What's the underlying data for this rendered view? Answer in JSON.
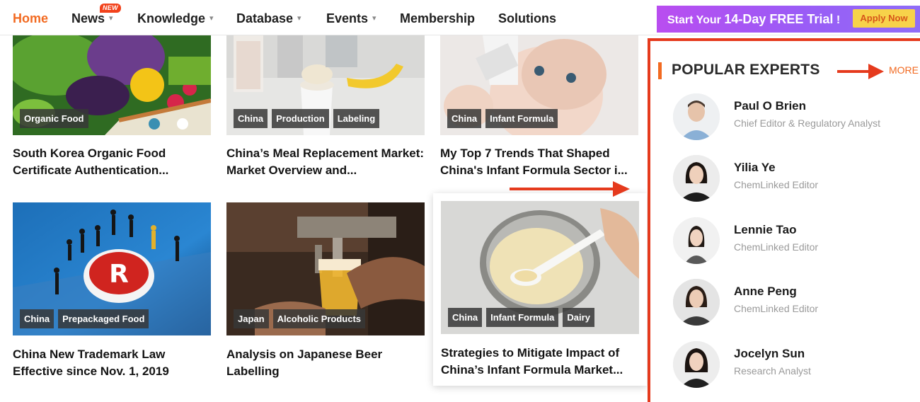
{
  "nav": {
    "items": [
      {
        "label": "Home",
        "active": true,
        "dropdown": false
      },
      {
        "label": "News",
        "active": false,
        "dropdown": true
      },
      {
        "label": "Knowledge",
        "active": false,
        "dropdown": true
      },
      {
        "label": "Database",
        "active": false,
        "dropdown": true
      },
      {
        "label": "Events",
        "active": false,
        "dropdown": true
      },
      {
        "label": "Membership",
        "active": false,
        "dropdown": false
      },
      {
        "label": "Solutions",
        "active": false,
        "dropdown": false
      }
    ],
    "new_badge": "NEW",
    "trial": {
      "text_prefix": "Start Your ",
      "text_highlight": "14-Day FREE Trial",
      "text_suffix": " !",
      "apply_label": "Apply Now"
    }
  },
  "articles": [
    {
      "tags": [
        "Organic Food"
      ],
      "title": "South Korea Organic Food Certificate Authentication..."
    },
    {
      "tags": [
        "China",
        "Production",
        "Labeling"
      ],
      "title": "China’s Meal Replacement Market: Market Overview and..."
    },
    {
      "tags": [
        "China",
        "Infant Formula"
      ],
      "title": "My Top 7 Trends That Shaped China's Infant Formula Sector i..."
    },
    {
      "tags": [
        "China",
        "Prepackaged Food"
      ],
      "title": "China New Trademark Law Effective since Nov. 1, 2019"
    },
    {
      "tags": [
        "Japan",
        "Alcoholic Products"
      ],
      "title": "Analysis on Japanese Beer Labelling"
    },
    {
      "tags": [
        "China",
        "Infant Formula",
        "Dairy"
      ],
      "title": "Strategies to Mitigate Impact of China’s Infant Formula Market..."
    }
  ],
  "sidebar": {
    "title": "POPULAR EXPERTS",
    "more_label": "MORE",
    "experts": [
      {
        "name": "Paul O Brien",
        "role": "Chief Editor & Regulatory Analyst"
      },
      {
        "name": "Yilia Ye",
        "role": "ChemLinked Editor"
      },
      {
        "name": "Lennie Tao",
        "role": "ChemLinked Editor"
      },
      {
        "name": "Anne Peng",
        "role": "ChemLinked Editor"
      },
      {
        "name": "Jocelyn Sun",
        "role": "Research Analyst"
      }
    ]
  },
  "colors": {
    "accent": "#f26a21",
    "annotation_red": "#e53a1d",
    "trial_gradient_start": "#b94df0",
    "apply_button": "#f7d24a"
  }
}
